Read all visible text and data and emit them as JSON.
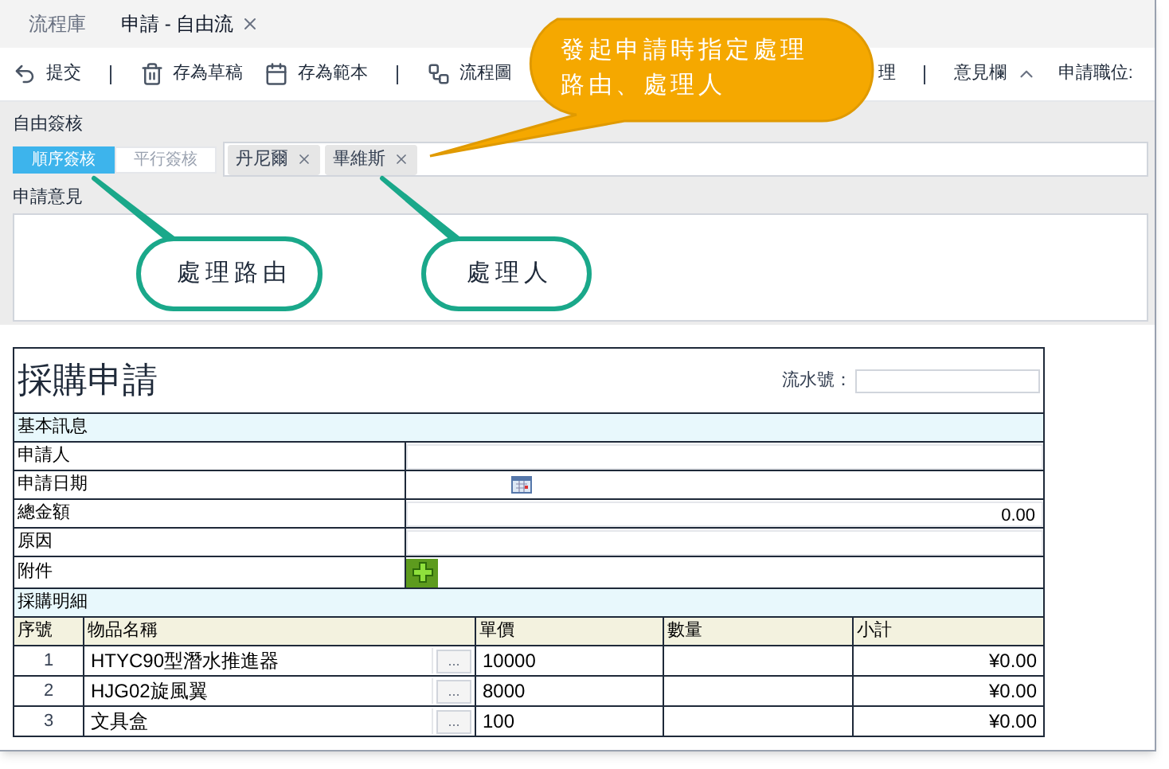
{
  "tabs": [
    {
      "label": "流程庫",
      "selected": false,
      "closable": false
    },
    {
      "label": "申請 - 自由流",
      "selected": true,
      "closable": true
    }
  ],
  "toolbar": [
    {
      "label": "提交",
      "kind": "submit",
      "divider_after": true
    },
    {
      "label": "存為草稿",
      "kind": "draft",
      "divider_after": false
    },
    {
      "label": "存為範本",
      "kind": "template",
      "divider_after": true
    },
    {
      "label": "流程圖",
      "kind": "flow",
      "divider_after": false
    },
    {
      "label": "理",
      "kind": "plain",
      "divider_after": true
    },
    {
      "label": "意見欄",
      "kind": "collapse",
      "divider_after": false
    },
    {
      "label": "申請職位:",
      "kind": "plain",
      "divider_after": false
    }
  ],
  "free_sign": {
    "label": "自由簽核",
    "modes": [
      {
        "label": "順序簽核",
        "selected": true
      },
      {
        "label": "平行簽核",
        "selected": false
      }
    ],
    "assignees": [
      "丹尼爾",
      "畢維斯"
    ]
  },
  "opinion": {
    "label": "申請意見"
  },
  "form": {
    "title": "採購申請",
    "serial_label": "流水號：",
    "basic_section": "基本訊息",
    "fields": [
      {
        "label": "申請人",
        "kind": "text"
      },
      {
        "label": "申請日期",
        "kind": "date"
      },
      {
        "label": "總金額",
        "kind": "amount",
        "value": "0.00"
      },
      {
        "label": "原因",
        "kind": "text"
      },
      {
        "label": "附件",
        "kind": "attach"
      }
    ],
    "detail_section": "採購明細",
    "columns": [
      "序號",
      "物品名稱",
      "單價",
      "數量",
      "小計"
    ],
    "rows": [
      {
        "no": "1",
        "name": "HTYC90型潛水推進器",
        "picker": "...",
        "price": "10000",
        "subtotal": "¥0.00"
      },
      {
        "no": "2",
        "name": "HJG02旋風翼",
        "picker": "...",
        "price": "8000",
        "subtotal": "¥0.00"
      },
      {
        "no": "3",
        "name": "文具盒",
        "picker": "...",
        "price": "100",
        "subtotal": "¥0.00"
      }
    ]
  },
  "callouts": [
    {
      "text": "發起申請時指定處理路由、處理人",
      "kind": "orange"
    },
    {
      "text": "處理路由",
      "kind": "green-left"
    },
    {
      "text": "處理人",
      "kind": "green-right"
    }
  ]
}
